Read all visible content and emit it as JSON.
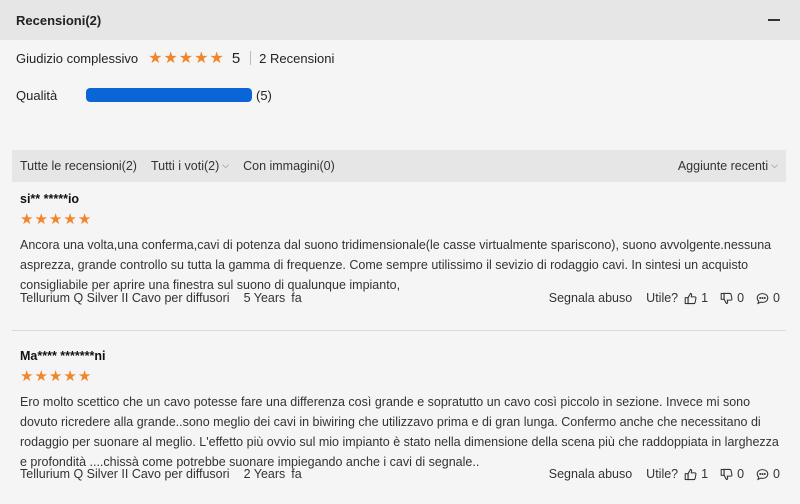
{
  "section": {
    "title": "Recensioni(2)"
  },
  "summary": {
    "overall_label": "Giudizio complessivo",
    "rating": 5,
    "score_text": "5",
    "reviews_count_text": "2 Recensioni",
    "quality_label": "Qualità",
    "quality_fraction": 1.0,
    "quality_count": "(5)"
  },
  "filters": {
    "all_reviews": "Tutte le recensioni(2)",
    "all_votes": "Tutti i voti(2)",
    "with_images": "Con immagini(0)",
    "sort": "Aggiunte recenti"
  },
  "reviews": [
    {
      "author": "si** *****io",
      "rating": 5,
      "text": "Ancora una volta,una conferma,cavi di potenza dal suono tridimensionale(le casse virtualmente spariscono), suono avvolgente.nessuna asprezza, grande controllo su tutta la gamma di frequenze. Come sempre utilissimo il sevizio di rodaggio cavi. In sintesi un acquisto consigliabile per aprire una finestra sul suono di qualunque impianto,",
      "product": "Tellurium Q Silver II Cavo per diffusori",
      "time": "5 Years",
      "time_suffix": "fa",
      "report": "Segnala abuso",
      "useful": "Utile?",
      "likes": "1",
      "dislikes": "0",
      "comments": "0"
    },
    {
      "author": "Ma**** *******ni",
      "rating": 5,
      "text": "Ero molto scettico che un cavo potesse fare una differenza così grande e sopratutto un cavo così piccolo in sezione. Invece mi sono dovuto ricredere alla grande..sono meglio dei cavi in biwiring che utilizzavo prima e di gran lunga. Confermo anche che necessitano di rodaggio per suonare al meglio. L'effetto più ovvio sul mio impianto è stato nella dimensione della scena più che raddoppiata in larghezza e profondità ....chissà come potrebbe suonare impiegando anche i cavi di segnale..",
      "product": "Tellurium Q Silver II Cavo per diffusori",
      "time": "2 Years",
      "time_suffix": "fa",
      "report": "Segnala abuso",
      "useful": "Utile?",
      "likes": "1",
      "dislikes": "0",
      "comments": "0"
    }
  ],
  "colors": {
    "star": "#f0862a",
    "bar": "#0a66d8",
    "header_bg": "#e6e6e6"
  },
  "icons": {
    "star": "star-icon",
    "like": "thumbs-up-icon",
    "dislike": "thumbs-down-icon",
    "comment": "comment-icon",
    "collapse": "minus-icon"
  }
}
